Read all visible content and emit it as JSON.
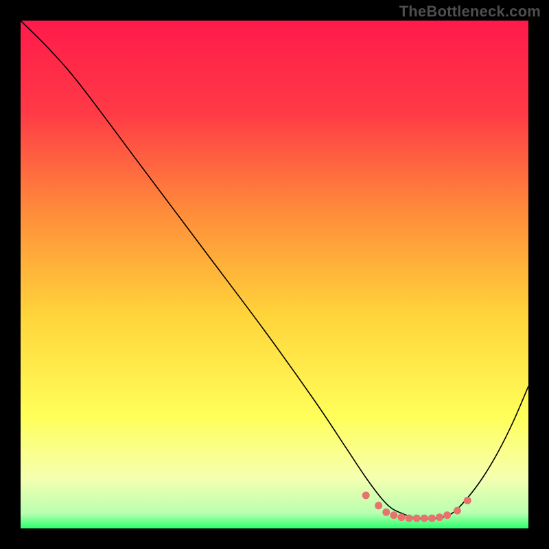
{
  "watermark": "TheBottleneck.com",
  "chart_data": {
    "type": "line",
    "title": "",
    "xlabel": "",
    "ylabel": "",
    "xlim": [
      0,
      100
    ],
    "ylim": [
      0,
      100
    ],
    "grid": false,
    "legend": null,
    "background_gradient": {
      "stops": [
        {
          "offset": 0.0,
          "color": "#ff1a4b"
        },
        {
          "offset": 0.18,
          "color": "#ff3a46"
        },
        {
          "offset": 0.38,
          "color": "#ff8d3a"
        },
        {
          "offset": 0.58,
          "color": "#ffd43a"
        },
        {
          "offset": 0.78,
          "color": "#ffff5a"
        },
        {
          "offset": 0.9,
          "color": "#f6ffb0"
        },
        {
          "offset": 0.97,
          "color": "#b9ffb0"
        },
        {
          "offset": 1.0,
          "color": "#2bff6c"
        }
      ]
    },
    "series": [
      {
        "name": "curve",
        "color": "#000000",
        "width": 1.6,
        "x": [
          0,
          6,
          12,
          24,
          36,
          48,
          58,
          64,
          68,
          71,
          73,
          75,
          78,
          82,
          85,
          88,
          91,
          94,
          97,
          100
        ],
        "y": [
          100,
          94,
          87,
          71,
          55,
          39,
          25,
          16,
          10,
          6,
          4,
          3,
          2,
          2,
          3,
          6,
          10,
          15,
          21,
          28
        ]
      }
    ],
    "markers": {
      "name": "sweet-spot",
      "color": "#e7736f",
      "radius": 5.5,
      "points": [
        {
          "x": 68.0,
          "y": 6.5
        },
        {
          "x": 70.5,
          "y": 4.5
        },
        {
          "x": 72.0,
          "y": 3.2
        },
        {
          "x": 73.5,
          "y": 2.6
        },
        {
          "x": 75.0,
          "y": 2.2
        },
        {
          "x": 76.5,
          "y": 2.0
        },
        {
          "x": 78.0,
          "y": 2.0
        },
        {
          "x": 79.5,
          "y": 2.0
        },
        {
          "x": 81.0,
          "y": 2.0
        },
        {
          "x": 82.5,
          "y": 2.2
        },
        {
          "x": 84.0,
          "y": 2.6
        },
        {
          "x": 86.0,
          "y": 3.5
        },
        {
          "x": 88.0,
          "y": 5.5
        }
      ]
    }
  }
}
